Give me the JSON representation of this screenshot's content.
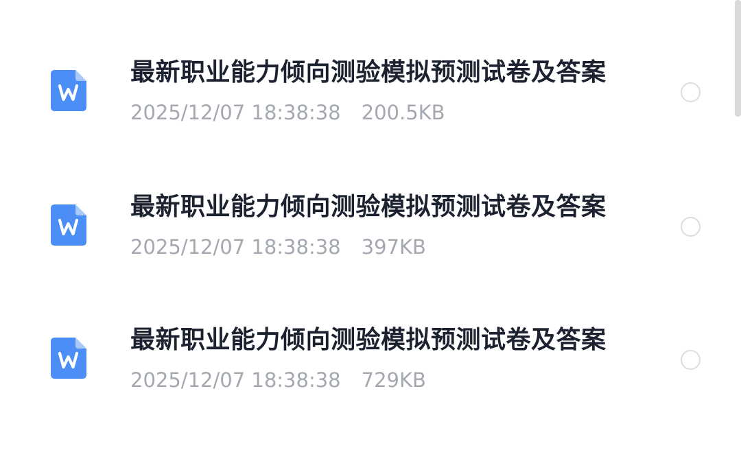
{
  "files": [
    {
      "title": "最新职业能力倾向测验模拟预测试卷及答案",
      "date": "2025/12/07 18:38:38",
      "size": "200.5KB",
      "icon": "word-doc-icon",
      "selected": false
    },
    {
      "title": "最新职业能力倾向测验模拟预测试卷及答案",
      "date": "2025/12/07 18:38:38",
      "size": "397KB",
      "icon": "word-doc-icon",
      "selected": false
    },
    {
      "title": "最新职业能力倾向测验模拟预测试卷及答案",
      "date": "2025/12/07 18:38:38",
      "size": "729KB",
      "icon": "word-doc-icon",
      "selected": false
    }
  ],
  "colors": {
    "icon_blue": "#4b8ef5",
    "title": "#1d2230",
    "meta": "#a4a8b0",
    "radio_border": "#dcdde0"
  }
}
